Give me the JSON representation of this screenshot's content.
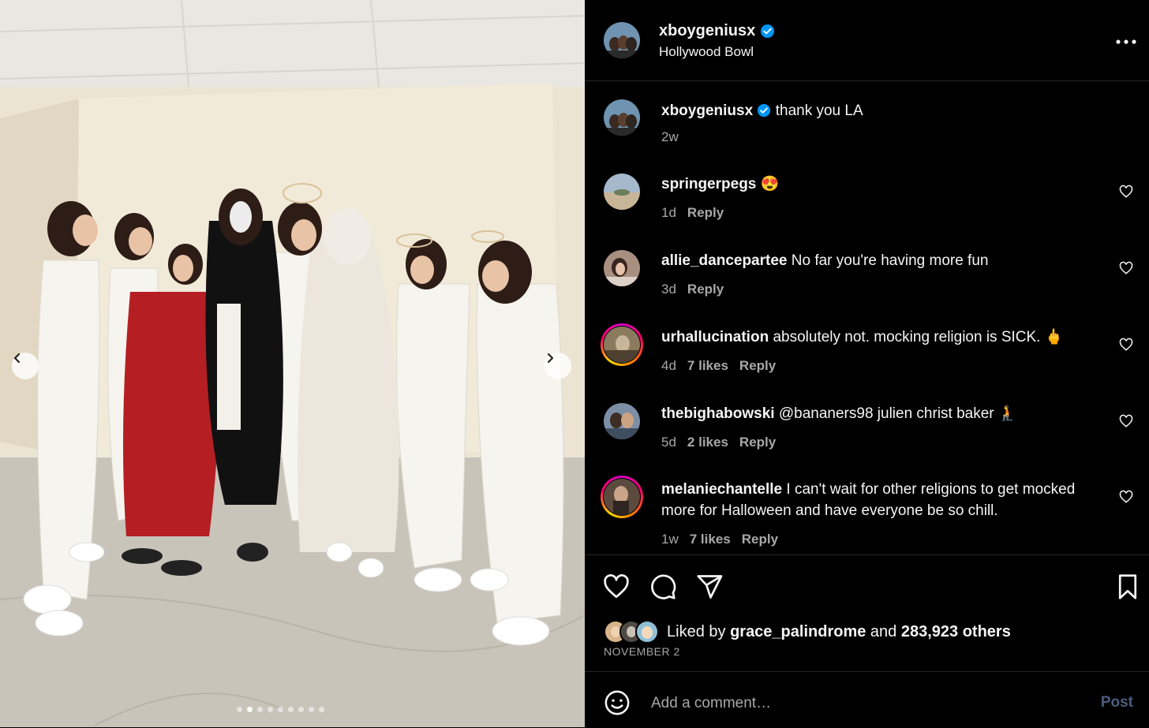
{
  "post": {
    "username": "xboygeniusx",
    "location": "Hollywood Bowl",
    "caption": "thank you LA",
    "caption_time": "2w",
    "carousel": {
      "total": 9,
      "active_index": 1
    }
  },
  "comments": [
    {
      "username": "springerpegs",
      "text": "😍",
      "time": "1d",
      "likes": "",
      "reply": "Reply"
    },
    {
      "username": "allie_dancepartee",
      "text": "No far you're having more fun",
      "time": "3d",
      "likes": "",
      "reply": "Reply"
    },
    {
      "username": "urhallucination",
      "text": "absolutely not. mocking religion is SICK. 🖕",
      "time": "4d",
      "likes": "7 likes",
      "reply": "Reply"
    },
    {
      "username": "thebighabowski",
      "text": "@bananers98 julien christ baker 🧎",
      "time": "5d",
      "likes": "2 likes",
      "reply": "Reply"
    },
    {
      "username": "melaniechantelle",
      "text": "I can't wait for other religions to get mocked more for Halloween and have everyone be so chill.",
      "time": "1w",
      "likes": "7 likes",
      "reply": "Reply"
    }
  ],
  "likes": {
    "prefix": "Liked by",
    "user": "grace_palindrome",
    "conj": "and",
    "count": "283,923 others"
  },
  "date": "NOVEMBER 2",
  "add_comment": {
    "placeholder": "Add a comment…",
    "post_label": "Post"
  },
  "icons": {
    "more": "more-options-icon",
    "verified": "verified-badge-icon",
    "like": "heart-icon",
    "comment": "comment-bubble-icon",
    "share": "share-paper-plane-icon",
    "save": "bookmark-icon",
    "emoji": "emoji-smiley-icon",
    "prev": "chevron-left-icon",
    "next": "chevron-right-icon"
  },
  "colors": {
    "background": "#000000",
    "verified": "#0095f6",
    "muted_text": "#a8a8a8",
    "post_disabled": "#4a5d7e"
  }
}
